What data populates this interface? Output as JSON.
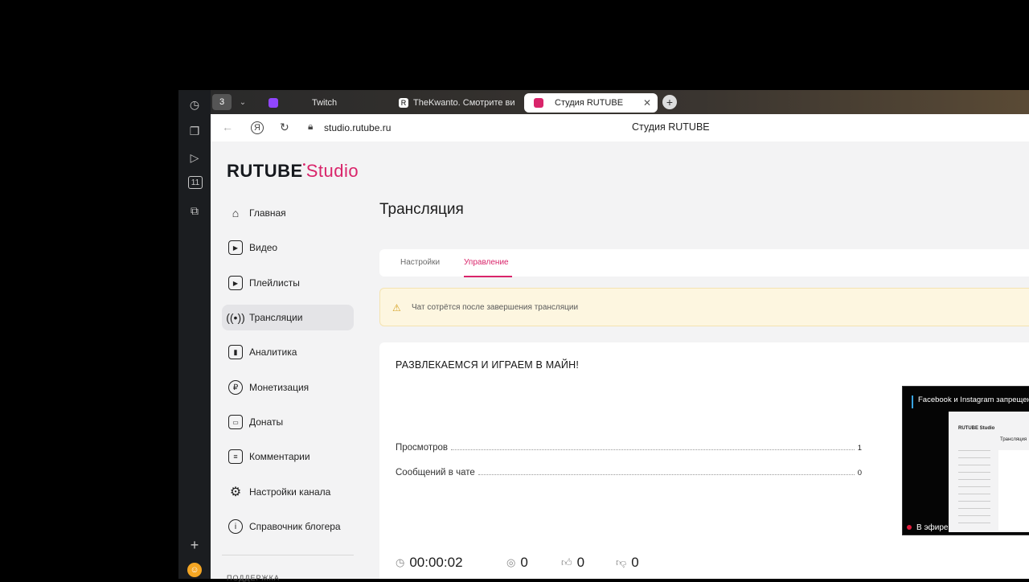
{
  "browser": {
    "tab_count": "3",
    "tabs": [
      {
        "title": "Twitch",
        "favicon_color": "#9146ff"
      },
      {
        "title": "TheKwanto. Смотрите ви",
        "favicon_color": "#ffffff"
      },
      {
        "title": "Студия RUTUBE",
        "favicon_color": "#d9246a",
        "active": true
      }
    ],
    "address": "studio.rutube.ru",
    "page_title": "Студия RUTUBE",
    "yandex_letter": "Я",
    "sidebar_badge": "11"
  },
  "logo": {
    "brand": "RUTUBE",
    "product": "Studio"
  },
  "sidebar": {
    "items": [
      {
        "label": "Главная",
        "icon": "home-icon"
      },
      {
        "label": "Видео",
        "icon": "video-icon"
      },
      {
        "label": "Плейлисты",
        "icon": "playlist-icon"
      },
      {
        "label": "Трансляции",
        "icon": "broadcast-icon",
        "active": true
      },
      {
        "label": "Аналитика",
        "icon": "analytics-icon"
      },
      {
        "label": "Монетизация",
        "icon": "ruble-icon"
      },
      {
        "label": "Донаты",
        "icon": "wallet-icon"
      },
      {
        "label": "Комментарии",
        "icon": "comment-icon"
      },
      {
        "label": "Настройки канала",
        "icon": "gear-icon"
      },
      {
        "label": "Справочник блогера",
        "icon": "info-icon"
      }
    ],
    "support_label": "ПОДДЕРЖКА"
  },
  "main": {
    "title": "Трансляция",
    "tabs": [
      {
        "label": "Настройки"
      },
      {
        "label": "Управление",
        "active": true
      }
    ],
    "alert": "Чат сотрётся после завершения трансляции",
    "stream_title": "РАЗВЛЕКАЕМСЯ И ИГРАЕМ В МАЙН!",
    "stats": [
      {
        "label": "Просмотров",
        "value": "1"
      },
      {
        "label": "Сообщений в чате",
        "value": "0"
      }
    ],
    "preview": {
      "banner": "Facebook и Instagram запрещены",
      "live_label": "В эфире",
      "mini_logo": "RUTUBE Studio",
      "mini_title": "Трансляция"
    },
    "bottom_stats": {
      "duration": "00:00:02",
      "viewers": "0",
      "likes": "0",
      "dislikes": "0"
    }
  },
  "colors": {
    "accent": "#d9246a",
    "live": "#e21b3c",
    "alert_bg": "#fdf6e0"
  }
}
